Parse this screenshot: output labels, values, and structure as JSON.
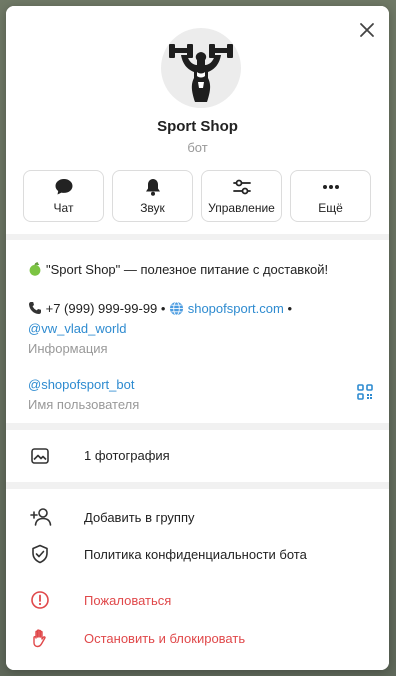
{
  "profile": {
    "name": "Sport Shop",
    "type": "бот"
  },
  "actions": [
    {
      "label": "Чат",
      "icon": "chat-bubble-icon"
    },
    {
      "label": "Звук",
      "icon": "bell-icon"
    },
    {
      "label": "Управление",
      "icon": "sliders-icon"
    },
    {
      "label": "Ещё",
      "icon": "more-dots-icon"
    }
  ],
  "info": {
    "description": "\"Sport Shop\" — полезное питание с доставкой!",
    "phone": "+7 (999) 999-99-99",
    "dot1": " •",
    "website": "shopofsport.com",
    "dot2": " •",
    "channel": "@vw_vlad_world",
    "info_caption": "Информация",
    "username": "@shopofsport_bot",
    "username_caption": "Имя пользователя"
  },
  "photos": {
    "label": "1 фотография"
  },
  "menu": {
    "add_to_group": "Добавить в группу",
    "privacy": "Политика конфиденциальности бота",
    "report": "Пожаловаться",
    "stop_block": "Остановить и блокировать"
  },
  "colors": {
    "accent": "#2e8bd0",
    "danger": "#e0484a",
    "muted": "#999999"
  }
}
